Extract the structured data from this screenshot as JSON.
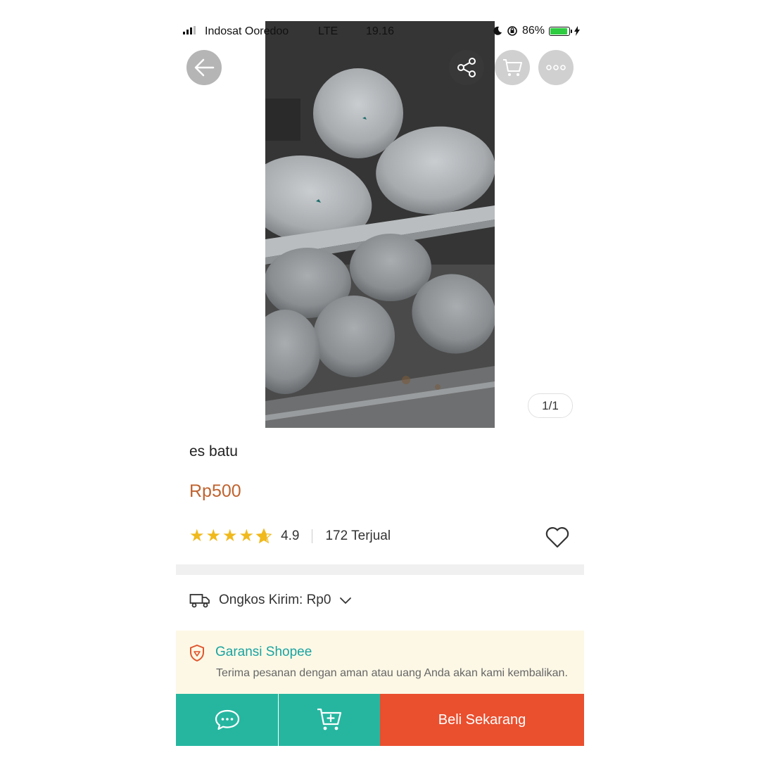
{
  "status_bar": {
    "carrier": "Indosat Ooredoo",
    "network": "LTE",
    "time": "19.16",
    "battery": "86%",
    "battery_level": 0.86
  },
  "image": {
    "counter": "1/1"
  },
  "icons": {
    "back": "arrow-left-icon",
    "share": "share-icon",
    "cart": "cart-icon",
    "more": "more-icon",
    "truck": "truck-icon",
    "shield": "shield-icon",
    "chat": "chat-icon",
    "cart_add": "cart-add-icon",
    "heart": "heart-icon",
    "chevron": "chevron-down-icon"
  },
  "product": {
    "title": "es batu",
    "price": "Rp500",
    "rating": "4.9",
    "rating_value": 4.9,
    "sold": "172 Terjual"
  },
  "shipping": {
    "label": "Ongkos Kirim: Rp0"
  },
  "guarantee": {
    "title": "Garansi Shopee",
    "description": "Terima pesanan dengan aman atau uang Anda akan kami kembalikan."
  },
  "bottom_bar": {
    "buy_label": "Beli Sekarang"
  },
  "colors": {
    "price": "#c0632f",
    "teal": "#26b6a0",
    "buy": "#ea4f2e",
    "star": "#f0b91c",
    "guarantee_title": "#1aa3a0"
  }
}
